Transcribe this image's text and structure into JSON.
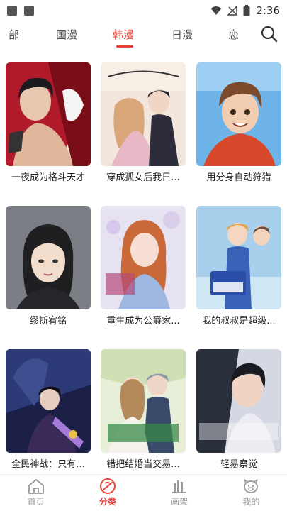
{
  "status_bar": {
    "time": "2:36"
  },
  "tabs": [
    {
      "label": "部"
    },
    {
      "label": "国漫"
    },
    {
      "label": "韩漫"
    },
    {
      "label": "日漫"
    },
    {
      "label": "恋"
    }
  ],
  "active_tab": "韩漫",
  "accent_color": "#e8453c",
  "comics": [
    {
      "title": "一夜成为格斗天才"
    },
    {
      "title": "穿成孤女后我日..."
    },
    {
      "title": "用分身自动狩猎"
    },
    {
      "title": "缪斯宥铭"
    },
    {
      "title": "重生成为公爵家..."
    },
    {
      "title": "我的叔叔是超级..."
    },
    {
      "title": "全民神战：只有..."
    },
    {
      "title": "错把结婚当交易..."
    },
    {
      "title": "轻易察觉"
    }
  ],
  "bottom_nav": [
    {
      "label": "首页",
      "icon": "home-icon"
    },
    {
      "label": "分类",
      "icon": "category-icon"
    },
    {
      "label": "画架",
      "icon": "shelf-icon"
    },
    {
      "label": "我的",
      "icon": "profile-icon"
    }
  ]
}
